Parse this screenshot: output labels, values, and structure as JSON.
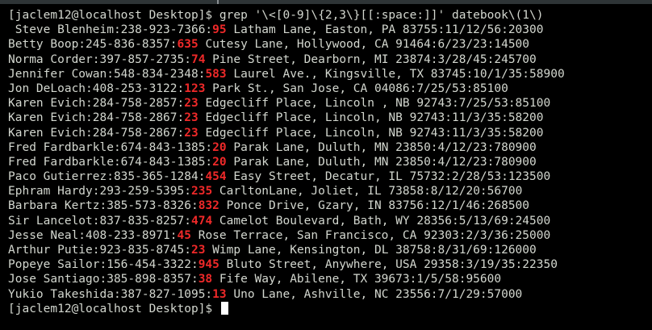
{
  "terminal": {
    "command_prompt": "[jaclem12@localhost Desktop]$ ",
    "command": "grep '\\<[0-9]\\{2,3\\}[[:space:]]' datebook\\(1\\)",
    "rows": [
      {
        "pre": " Steve Blenheim:238-923-7366:",
        "match": "95",
        "post": " Latham Lane, Easton, PA 83755:11/12/56:20300"
      },
      {
        "pre": "Betty Boop:245-836-8357:",
        "match": "635",
        "post": " Cutesy Lane, Hollywood, CA 91464:6/23/23:14500"
      },
      {
        "pre": "Norma Corder:397-857-2735:",
        "match": "74",
        "post": " Pine Street, Dearborn, MI 23874:3/28/45:245700"
      },
      {
        "pre": "Jennifer Cowan:548-834-2348:",
        "match": "583",
        "post": " Laurel Ave., Kingsville, TX 83745:10/1/35:58900"
      },
      {
        "pre": "Jon DeLoach:408-253-3122:",
        "match": "123",
        "post": " Park St., San Jose, CA 04086:7/25/53:85100"
      },
      {
        "pre": "Karen Evich:284-758-2857:",
        "match": "23",
        "post": " Edgecliff Place, Lincoln , NB 92743:7/25/53:85100"
      },
      {
        "pre": "Karen Evich:284-758-2867:",
        "match": "23",
        "post": " Edgecliff Place, Lincoln, NB 92743:11/3/35:58200"
      },
      {
        "pre": "Karen Evich:284-758-2867:",
        "match": "23",
        "post": " Edgecliff Place, Lincoln, NB 92743:11/3/35:58200"
      },
      {
        "pre": "Fred Fardbarkle:674-843-1385:",
        "match": "20",
        "post": " Parak Lane, Duluth, MN 23850:4/12/23:780900"
      },
      {
        "pre": "Fred Fardbarkle:674-843-1385:",
        "match": "20",
        "post": " Parak Lane, Duluth, MN 23850:4/12/23:780900"
      },
      {
        "pre": "Paco Gutierrez:835-365-1284:",
        "match": "454",
        "post": " Easy Street, Decatur, IL 75732:2/28/53:123500"
      },
      {
        "pre": "Ephram Hardy:293-259-5395:",
        "match": "235",
        "post": " CarltonLane, Joliet, IL 73858:8/12/20:56700"
      },
      {
        "pre": "Barbara Kertz:385-573-8326:",
        "match": "832",
        "post": " Ponce Drive, Gzary, IN 83756:12/1/46:268500"
      },
      {
        "pre": "Sir Lancelot:837-835-8257:",
        "match": "474",
        "post": " Camelot Boulevard, Bath, WY 28356:5/13/69:24500"
      },
      {
        "pre": "Jesse Neal:408-233-8971:",
        "match": "45",
        "post": " Rose Terrace, San Francisco, CA 92303:2/3/36:25000"
      },
      {
        "pre": "Arthur Putie:923-835-8745:",
        "match": "23",
        "post": " Wimp Lane, Kensington, DL 38758:8/31/69:126000"
      },
      {
        "pre": "Popeye Sailor:156-454-3322:",
        "match": "945",
        "post": " Bluto Street, Anywhere, USA 29358:3/19/35:22350"
      },
      {
        "pre": "Jose Santiago:385-898-8357:",
        "match": "38",
        "post": " Fife Way, Abilene, TX 39673:1/5/58:95600"
      },
      {
        "pre": "Yukio Takeshida:387-827-1095:",
        "match": "13",
        "post": " Uno Lane, Ashville, NC 23556:7/1/29:57000"
      }
    ],
    "final_prompt": "[jaclem12@localhost Desktop]$ "
  },
  "colors": {
    "background": "#000000",
    "text": "#d3d7cf",
    "match": "#ef2929",
    "cursor": "#ffffff"
  }
}
